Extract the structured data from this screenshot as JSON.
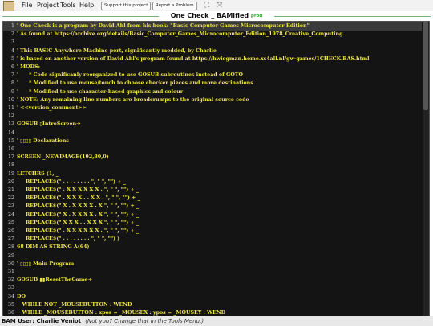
{
  "menu": {
    "items": [
      "File",
      "Project",
      "Tools",
      "Help"
    ],
    "support_label": "Support this project",
    "report_label": "Report a Problem"
  },
  "title": {
    "name": "One Check _ BAMified",
    "badge": "prod"
  },
  "editor": {
    "lines": [
      {
        "n": "1",
        "text": "' One Check is a program by David Ahl from his book: \"Basic Computer Games Microcomputer Edition\"",
        "hl": true
      },
      {
        "n": "2",
        "text": "' As found at https://archive.org/details/Basic_Computer_Games_Microcomputer_Edition_1978_Creative_Computing"
      },
      {
        "n": "3",
        "text": ""
      },
      {
        "n": "4",
        "text": "' This BASIC Anywhere Machine port, significantly modded, by Charlie"
      },
      {
        "n": "5",
        "text": "' is based on another version of David Ahl's program found at https://hwiegman.home.xs4all.nl/gw-games/1CHECK.BAS.html"
      },
      {
        "n": "6",
        "text": "' MODS:"
      },
      {
        "n": "7",
        "text": "'      * Code significanly reorganized to use GOSUB subroutines instead of GOTO"
      },
      {
        "n": "8",
        "text": "'      * Modified to use mouse/touch to choose checker pieces and move destinations"
      },
      {
        "n": "9",
        "text": "'      * Modified to use character-based graphics and colour"
      },
      {
        "n": "10",
        "text": "' NOTE: Any remaining line numbers are breadcrumps to the original source code"
      },
      {
        "n": "11",
        "text": "' <<version_comment>>"
      },
      {
        "n": "12",
        "text": ""
      },
      {
        "n": "13",
        "text": "GOSUB ▯IntroScreen➔"
      },
      {
        "n": "14",
        "text": ""
      },
      {
        "n": "15",
        "text": "' ▯▯▯▯ Declarations"
      },
      {
        "n": "16",
        "text": ""
      },
      {
        "n": "17",
        "text": "SCREEN _NEWIMAGE(192,80,0)"
      },
      {
        "n": "18",
        "text": ""
      },
      {
        "n": "19",
        "text": "LETCHRS (1, _"
      },
      {
        "n": "20",
        "text": "     REPLACE$(\" . . . . . . . . \", \" \", \"\") + _"
      },
      {
        "n": "21",
        "text": "     REPLACE$(\" . X X X X X X . \", \" \", \"\") + _"
      },
      {
        "n": "22",
        "text": "     REPLACE$(\" . X X X . . X X . \", \" \", \"\") + _"
      },
      {
        "n": "23",
        "text": "     REPLACE$(\" X . X X X X . X \", \" \", \"\") + _"
      },
      {
        "n": "24",
        "text": "     REPLACE$(\" X . X X X X . X \", \" \", \"\") + _"
      },
      {
        "n": "25",
        "text": "     REPLACE$(\" X X X . . X X X \", \" \", \"\") + _"
      },
      {
        "n": "26",
        "text": "     REPLACE$(\" . X X X X X X . \", \" \", \"\") + _"
      },
      {
        "n": "27",
        "text": "     REPLACE$(\" . . . . . . . . \", \" \", \"\") )"
      },
      {
        "n": "28",
        "text": "68 DIM AS STRING A(64)"
      },
      {
        "n": "29",
        "text": ""
      },
      {
        "n": "30",
        "text": "' ▯▯▯▯ Main Program"
      },
      {
        "n": "31",
        "text": ""
      },
      {
        "n": "32",
        "text": "GOSUB ▮▮ResetTheGame➔"
      },
      {
        "n": "33",
        "text": ""
      },
      {
        "n": "34",
        "text": "DO"
      },
      {
        "n": "35",
        "text": "   WHILE NOT _MOUSEBUTTON : WEND"
      },
      {
        "n": "36",
        "text": "   WHILE _MOUSEBUTTON : xpos = _MOUSEX : ypos = _MOUSEY : WEND"
      }
    ]
  },
  "status": {
    "user": "BAM User: Charlie Veniot",
    "hint": "(Not you? Change that in the Tools Menu.)"
  }
}
